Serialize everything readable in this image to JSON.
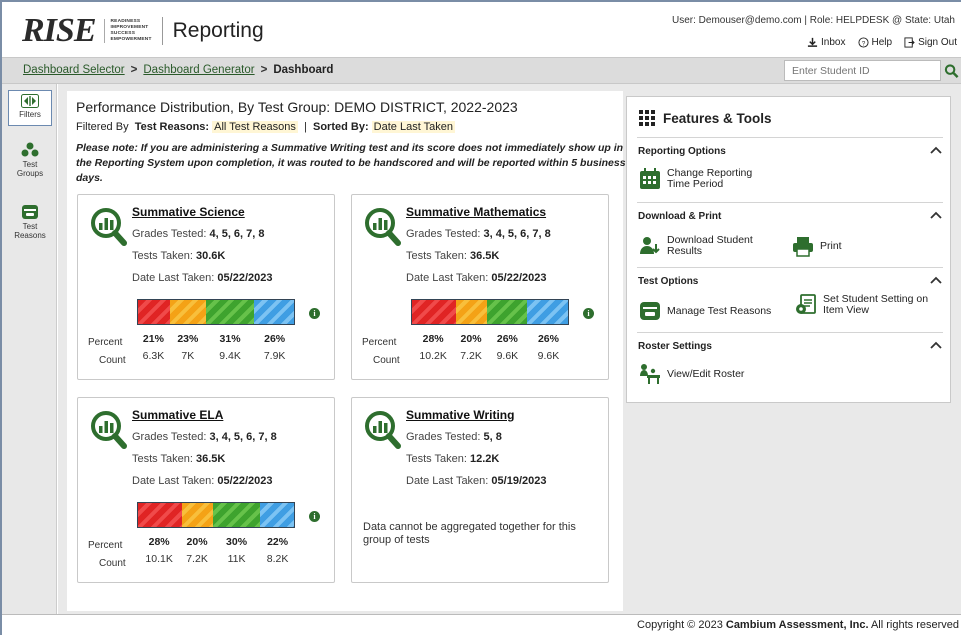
{
  "header": {
    "logo_text": "RISE",
    "logo_sub_lines": [
      "READINESS",
      "IMPROVEMENT",
      "SUCCESS",
      "EMPOWERMENT"
    ],
    "app_title": "Reporting",
    "user_info": "User: Demouser@demo.com  |  Role: HELPDESK @ State: Utah",
    "inbox": "Inbox",
    "help": "Help",
    "sign_out": "Sign Out"
  },
  "breadcrumb": {
    "items": [
      "Dashboard Selector",
      "Dashboard Generator",
      "Dashboard"
    ],
    "separator": ">"
  },
  "search": {
    "placeholder": "Enter Student ID"
  },
  "rail": {
    "filters": "Filters",
    "test_groups": [
      "Test",
      "Groups"
    ],
    "test_reasons": [
      "Test",
      "Reasons"
    ]
  },
  "main": {
    "title": "Performance Distribution, By Test Group: DEMO DISTRICT, 2022-2023",
    "filtered_by_label": "Filtered By",
    "test_reasons_label": "Test Reasons:",
    "test_reasons_value": "All Test Reasons",
    "sorted_by_label": "Sorted By:",
    "sorted_by_value": "Date Last Taken",
    "separator": "|",
    "note": "Please note: If you are administering a Summative Writing test and its score does not immediately show up in the Reporting System upon completion, it was routed to be handscored and will be reported within 5 business days."
  },
  "labels": {
    "grades_tested": "Grades Tested:",
    "tests_taken": "Tests Taken:",
    "date_last_taken": "Date Last Taken:",
    "percent": "Percent",
    "count": "Count"
  },
  "cards": [
    {
      "title": "Summative Science",
      "grades": "4, 5, 6, 7, 8",
      "tests_taken": "30.6K",
      "date_last_taken": "05/22/2023",
      "levels": [
        {
          "percent_value": 21,
          "percent": "21%",
          "count": "6.3K",
          "color": "red"
        },
        {
          "percent_value": 23,
          "percent": "23%",
          "count": "7K",
          "color": "orange"
        },
        {
          "percent_value": 31,
          "percent": "31%",
          "count": "9.4K",
          "color": "green"
        },
        {
          "percent_value": 26,
          "percent": "26%",
          "count": "7.9K",
          "color": "blue"
        }
      ]
    },
    {
      "title": "Summative Mathematics",
      "grades": "3, 4, 5, 6, 7, 8",
      "tests_taken": "36.5K",
      "date_last_taken": "05/22/2023",
      "levels": [
        {
          "percent_value": 28,
          "percent": "28%",
          "count": "10.2K",
          "color": "red"
        },
        {
          "percent_value": 20,
          "percent": "20%",
          "count": "7.2K",
          "color": "orange"
        },
        {
          "percent_value": 26,
          "percent": "26%",
          "count": "9.6K",
          "color": "green"
        },
        {
          "percent_value": 26,
          "percent": "26%",
          "count": "9.6K",
          "color": "blue"
        }
      ]
    },
    {
      "title": "Summative ELA",
      "grades": "3, 4, 5, 6, 7, 8",
      "tests_taken": "36.5K",
      "date_last_taken": "05/22/2023",
      "levels": [
        {
          "percent_value": 28,
          "percent": "28%",
          "count": "10.1K",
          "color": "red"
        },
        {
          "percent_value": 20,
          "percent": "20%",
          "count": "7.2K",
          "color": "orange"
        },
        {
          "percent_value": 30,
          "percent": "30%",
          "count": "11K",
          "color": "green"
        },
        {
          "percent_value": 22,
          "percent": "22%",
          "count": "8.2K",
          "color": "blue"
        }
      ]
    },
    {
      "title": "Summative Writing",
      "grades": "5, 8",
      "tests_taken": "12.2K",
      "date_last_taken": "05/19/2023",
      "no_data_message": "Data cannot be aggregated together for this group of tests"
    }
  ],
  "features": {
    "title": "Features & Tools",
    "sections": [
      {
        "heading": "Reporting Options",
        "items": [
          "Change Reporting Time Period"
        ]
      },
      {
        "heading": "Download & Print",
        "items": [
          "Download Student Results",
          "Print"
        ]
      },
      {
        "heading": "Test Options",
        "items": [
          "Manage Test Reasons",
          "Set Student Setting on Item View"
        ]
      },
      {
        "heading": "Roster Settings",
        "items": [
          "View/Edit Roster"
        ]
      }
    ]
  },
  "footer": {
    "copyright_prefix": "Copyright © 2023 ",
    "company": "Cambium Assessment, Inc.",
    "copyright_suffix": " All rights reserved"
  },
  "colors": {
    "brand_green": "#2e6e2e",
    "red": "#e02424",
    "orange": "#f4a216",
    "green": "#3ea32e",
    "blue": "#3f9ee3",
    "highlight": "#fff6d5"
  }
}
